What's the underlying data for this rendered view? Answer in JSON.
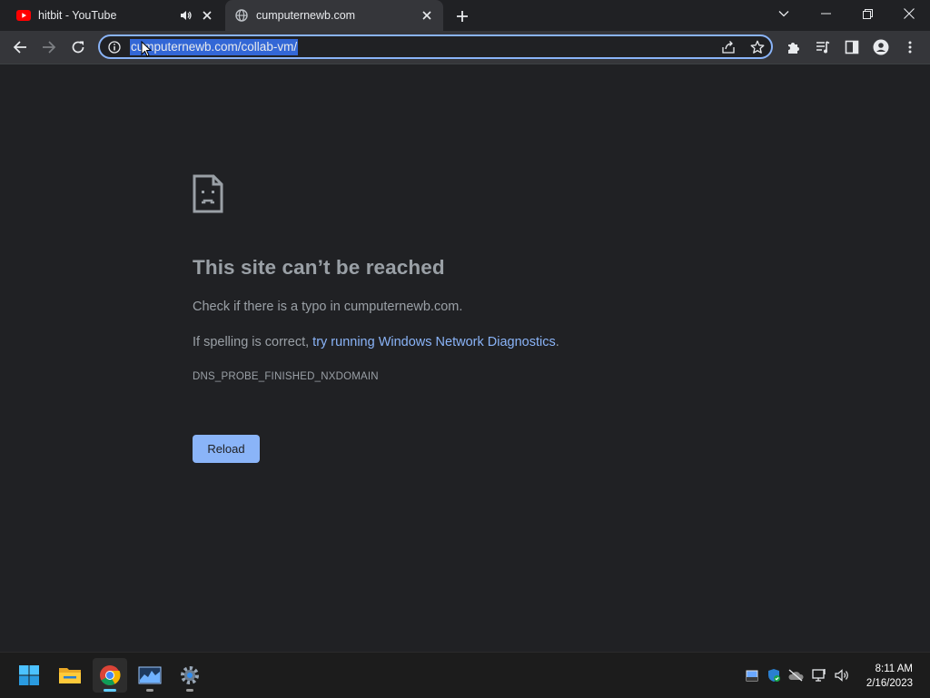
{
  "browser": {
    "tabs": [
      {
        "title": "hitbit - YouTube",
        "favicon": "youtube-icon",
        "audio": "speaker-icon"
      },
      {
        "title": "cumputernewb.com",
        "favicon": "globe-icon"
      }
    ],
    "omnibox": {
      "url": "cumputernewb.com/collab-vm/"
    }
  },
  "page": {
    "title": "This site can’t be reached",
    "line1": "Check if there is a typo in cumputernewb.com.",
    "line2_prefix": "If spelling is correct, ",
    "line2_link": "try running Windows Network Diagnostics",
    "line2_suffix": ".",
    "error_code": "DNS_PROBE_FINISHED_NXDOMAIN",
    "reload_label": "Reload"
  },
  "taskbar": {
    "apps": [
      "windows-start-icon",
      "file-explorer-icon",
      "chrome-icon",
      "task-manager-icon",
      "settings-icon"
    ],
    "time": "8:11 AM",
    "date": "2/16/2023"
  },
  "colors": {
    "background": "#202124",
    "accent": "#8ab4f8",
    "selection": "#3367d6"
  }
}
